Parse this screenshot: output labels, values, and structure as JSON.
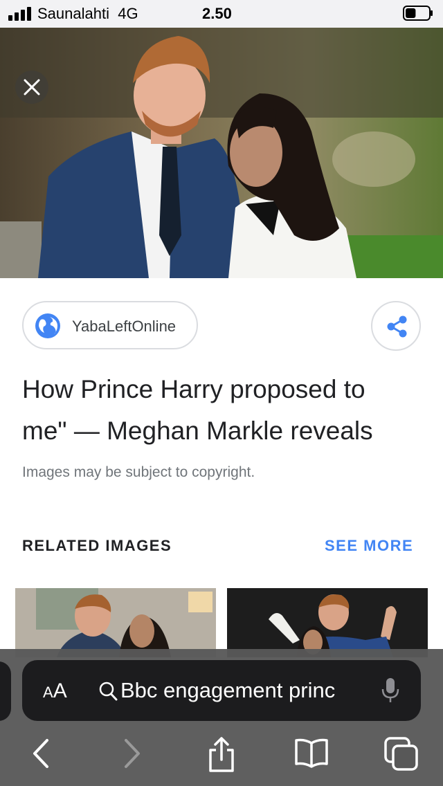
{
  "status_bar": {
    "carrier": "Saunalahti",
    "network": "4G",
    "time": "2.50",
    "signal_bars": 4,
    "battery_level": 0.45
  },
  "hero": {
    "close_icon": "close-icon",
    "image": "photo-couple-portrait"
  },
  "source": {
    "icon": "globe-icon",
    "name": "YabaLeftOnline"
  },
  "share": {
    "icon": "share-icon"
  },
  "article": {
    "title_line_1": "How Prince Harry proposed to",
    "title_line_2": "me\" — Meghan Markle reveals",
    "copyright_note": "Images may be subject to copyright."
  },
  "related": {
    "title": "RELATED IMAGES",
    "see_more": "SEE MORE",
    "thumbnails": [
      "related-image-1",
      "related-image-2"
    ]
  },
  "browser": {
    "aa_small": "A",
    "aa_big": "A",
    "url_text": "Bbc engagement princ",
    "icons": {
      "search": "search-icon",
      "mic": "microphone-icon",
      "back": "back-icon",
      "forward": "forward-icon",
      "share": "share-sheet-icon",
      "bookmarks": "bookmarks-icon",
      "tabs": "tabs-icon"
    }
  },
  "colors": {
    "accent": "#4285f4",
    "status_bar_bg": "#f2f2f4",
    "toolbar_bg": "#585858",
    "pill_bg": "#1c1c1e"
  }
}
